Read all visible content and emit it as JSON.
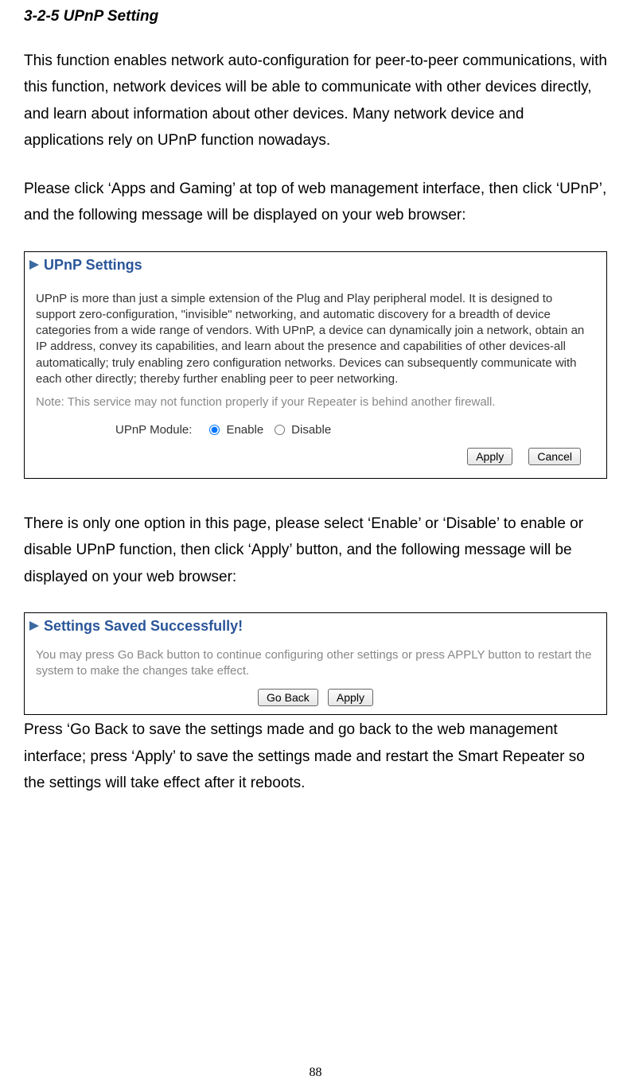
{
  "heading": "3-2-5 UPnP Setting",
  "para1": "This function enables network auto-configuration for peer-to-peer communications, with this function, network devices will be able to communicate with other devices directly, and learn about information about other devices. Many network device and applications rely on UPnP function nowadays.",
  "para2": "Please click ‘Apps and Gaming’ at top of web management interface, then click ‘UPnP’, and the following message will be displayed on your web browser:",
  "shot1": {
    "title": "UPnP Settings",
    "desc": "UPnP is more than just a simple extension of the Plug and Play peripheral model. It is designed to support zero-configuration, \"invisible\" networking, and automatic discovery for a breadth of device categories from a wide range of vendors. With UPnP, a device can dynamically join a network, obtain an IP address, convey its capabilities, and learn about the presence and capabilities of other devices-all automatically; truly enabling zero configuration networks. Devices can subsequently communicate with each other directly; thereby further enabling peer to peer networking.",
    "note": "Note: This service may not function properly if your Repeater is behind another firewall.",
    "radio_label": "UPnP Module:",
    "opt_enable": "Enable",
    "opt_disable": "Disable",
    "btn_apply": "Apply",
    "btn_cancel": "Cancel"
  },
  "para3": "There is only one option in this page, please select ‘Enable’ or ‘Disable’ to enable or disable UPnP function, then click ‘Apply’ button, and the following message will be displayed on your web browser:",
  "shot2": {
    "title": "Settings Saved Successfully!",
    "text": "You may press Go Back button to continue configuring other settings or press APPLY button to restart the system to make the changes take effect.",
    "btn_goback": "Go Back",
    "btn_apply": "Apply"
  },
  "para4": "Press ‘Go Back to save the settings made and go back to the web management interface; press ‘Apply’ to save the settings made and restart the Smart Repeater so the settings will take effect after it reboots.",
  "page_number": "88"
}
